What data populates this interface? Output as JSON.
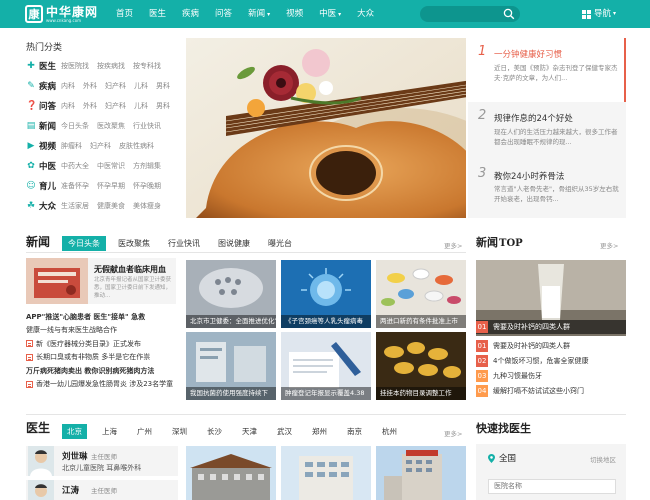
{
  "header": {
    "logo_char": "康",
    "logo_text": "中华康网",
    "logo_url": "www.cnkang.com",
    "nav": [
      {
        "label": "首页"
      },
      {
        "label": "医生"
      },
      {
        "label": "疾病"
      },
      {
        "label": "问答"
      },
      {
        "label": "新闻",
        "dropdown": true
      },
      {
        "label": "视频"
      },
      {
        "label": "中医",
        "dropdown": true
      },
      {
        "label": "大众"
      }
    ],
    "search_placeholder": "",
    "guide_label": "导航"
  },
  "hot": {
    "title": "热门分类",
    "categories": [
      {
        "name": "医生",
        "icon": "doctor-icon",
        "glyph": "✚",
        "subs": [
          "按医院找",
          "按疾病找",
          "按专科找"
        ]
      },
      {
        "name": "疾病",
        "icon": "pill-icon",
        "glyph": "✎",
        "subs": [
          "内科",
          "外科",
          "妇产科",
          "儿科",
          "男科"
        ]
      },
      {
        "name": "问答",
        "icon": "qa-icon",
        "glyph": "❓",
        "subs": [
          "内科",
          "外科",
          "妇产科",
          "儿科",
          "男科"
        ]
      },
      {
        "name": "新闻",
        "icon": "news-icon",
        "glyph": "▤",
        "subs": [
          "今日头条",
          "医改聚焦",
          "行业快讯"
        ]
      },
      {
        "name": "视频",
        "icon": "video-icon",
        "glyph": "▶",
        "subs": [
          "肿瘤科",
          "妇产科",
          "皮肤性病科"
        ]
      },
      {
        "name": "中医",
        "icon": "tcm-icon",
        "glyph": "✿",
        "subs": [
          "中药大全",
          "中医常识",
          "方剂辑集"
        ]
      },
      {
        "name": "育儿",
        "icon": "baby-icon",
        "glyph": "☺",
        "subs": [
          "准备怀孕",
          "怀孕早期",
          "怀孕晚期"
        ]
      },
      {
        "name": "大众",
        "icon": "people-icon",
        "glyph": "☘",
        "subs": [
          "生活家居",
          "健康美食",
          "美体瘦身"
        ]
      }
    ]
  },
  "featured": [
    {
      "num": "1",
      "title": "一分钟健康好习惯",
      "desc": "近日，美国《预防》杂志刊登了保健专家杰夫·克萨的文章，为人们..."
    },
    {
      "num": "2",
      "title": "规律作息的24个好处",
      "desc": "现在人们的生活压力越来越大，很多工作者都会出现睡眠不规律的现..."
    },
    {
      "num": "3",
      "title": "教你24小时养骨法",
      "desc": "常言道\"人老骨先老\"，骨组织从35岁左右就开始衰老，出现骨钙..."
    }
  ],
  "news": {
    "title": "新闻",
    "tabs": [
      "今日头条",
      "医改聚焦",
      "行业快讯",
      "图说健康",
      "曝光台"
    ],
    "more": "更多>",
    "feature_title": "无假献血者临床用血",
    "feature_desc": "北京青年报记者从国家卫计委获悉，国家卫计委日前下发通知，推动...",
    "lines": [
      {
        "text": "APP\"推送\"心脑患者 医生\"接单\" 急救",
        "bold": true,
        "icon": false
      },
      {
        "text": "健康一线与有来医生战略合作",
        "bold": false,
        "icon": false
      },
      {
        "text": "新《医疗器械分类目录》正式发布",
        "bold": false,
        "icon": true
      },
      {
        "text": "长期口臭或有非物质 多半是它在作祟",
        "bold": false,
        "icon": true
      },
      {
        "text": "万斤病死猪肉卖出 教你识别病死猪肉方法",
        "bold": true,
        "icon": false
      },
      {
        "text": "香港一幼儿园爆发急性肠胃炎 涉及23名学童",
        "bold": false,
        "icon": true
      }
    ],
    "photos": [
      "北京市卫健委：全面推进优化专家",
      "《子宫颈癌等人乳头瘤病毒",
      "两进口新药有条件批准上市",
      "我国抗菌药使用强度持续下",
      "肿瘤登记年报显示覆盖4.38",
      "挂挂本药物目录调整工作"
    ]
  },
  "ntop": {
    "title": "新闻",
    "title_suffix": "TOP",
    "more": "更多>",
    "items": [
      "需要及时补钙的四类人群",
      "需要及时补钙的四类人群",
      "4个做饭坏习惯，危害全家健康",
      "九种习惯最伤牙",
      "缓解打嗝不妨试试这些小窍门"
    ]
  },
  "doctors": {
    "title": "医生",
    "cities": [
      "北京",
      "上海",
      "广州",
      "深圳",
      "长沙",
      "天津",
      "武汉",
      "郑州",
      "南京",
      "杭州"
    ],
    "more": "更多>",
    "list": [
      {
        "name": "刘世琳",
        "title": "主任医师",
        "hospital": "北京儿童医院 耳鼻喉外科"
      },
      {
        "name": "江涛",
        "title": "主任医师",
        "hospital": ""
      }
    ]
  },
  "finder": {
    "title": "快速找医生",
    "location": "全国",
    "switch": "切换地区",
    "hospital_placeholder": "医院名称"
  }
}
